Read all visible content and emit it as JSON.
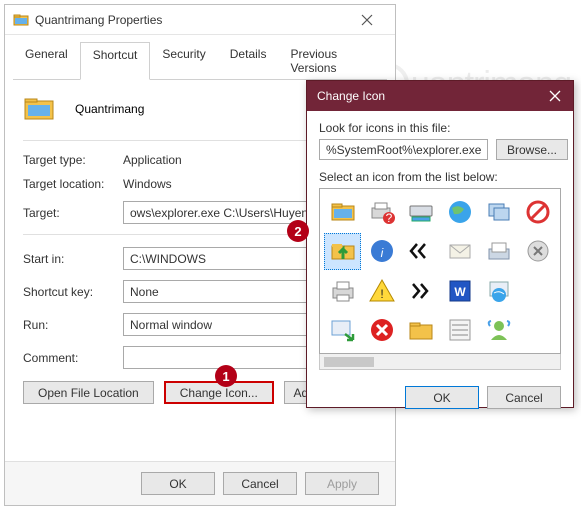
{
  "props": {
    "title": "Quantrimang Properties",
    "heading": "Quantrimang",
    "tabs": [
      "General",
      "Shortcut",
      "Security",
      "Details",
      "Previous Versions"
    ],
    "active_tab": "Shortcut",
    "labels": {
      "target_type": "Target type:",
      "target_location": "Target location:",
      "target": "Target:",
      "start_in": "Start in:",
      "shortcut_key": "Shortcut key:",
      "run": "Run:",
      "comment": "Comment:"
    },
    "values": {
      "target_type": "Application",
      "target_location": "Windows",
      "target": "ows\\explorer.exe C:\\Users\\HuyenSP\\",
      "start_in": "C:\\WINDOWS",
      "shortcut_key": "None",
      "run": "Normal window",
      "comment": ""
    },
    "buttons": {
      "open_file_location": "Open File Location",
      "change_icon": "Change Icon...",
      "advanced": "Adv",
      "ok": "OK",
      "cancel": "Cancel",
      "apply": "Apply"
    }
  },
  "change_icon": {
    "title": "Change Icon",
    "look_label": "Look for icons in this file:",
    "path": "%SystemRoot%\\explorer.exe",
    "browse": "Browse...",
    "select_label": "Select an icon from the list below:",
    "ok": "OK",
    "cancel": "Cancel",
    "icons": [
      "folder-icon",
      "printer-question-icon",
      "drive-icon",
      "globe-icon",
      "windows-stack-icon",
      "no-entry-icon",
      "folder-up-icon",
      "info-icon",
      "chevrons-left-icon",
      "envelope-icon",
      "inbox-icon",
      "close-grey-icon",
      "printer-icon",
      "warning-icon",
      "chevrons-right-icon",
      "word-blue-icon",
      "browser-globe-icon",
      "blank",
      "window-arrow-icon",
      "error-red-icon",
      "folder-yellow-icon",
      "list-view-icon",
      "msn-person-icon",
      "blank"
    ],
    "selected_index": 6
  },
  "annotations": {
    "step1": "1",
    "step2": "2"
  },
  "watermark": "uantrimang"
}
